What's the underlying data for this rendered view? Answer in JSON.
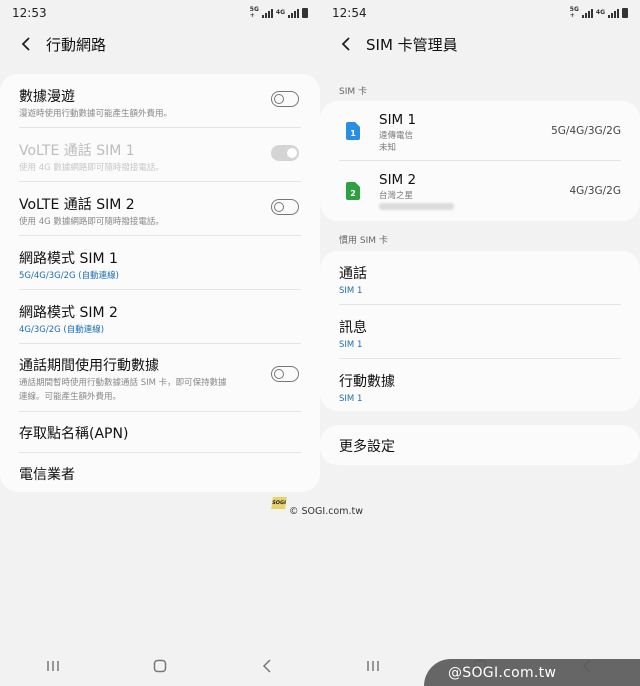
{
  "left": {
    "status_time": "12:53",
    "status_net1": "4G",
    "header_title": "行動網路",
    "rows": [
      {
        "title": "數據漫遊",
        "sub": "漫遊時使用行動數據可能產生額外費用。"
      },
      {
        "title": "VoLTE 通話 SIM 1",
        "sub": "使用 4G 數據網路即可隨時撥接電話。"
      },
      {
        "title": "VoLTE 通話 SIM 2",
        "sub": "使用 4G 數據網路即可隨時撥接電話。"
      },
      {
        "title": "網路模式 SIM 1",
        "sub": "5G/4G/3G/2G (自動連線)"
      },
      {
        "title": "網路模式 SIM 2",
        "sub": "4G/3G/2G (自動連線)"
      },
      {
        "title": "通話期間使用行動數據",
        "sub1": "通話期間暫時使用行動數據通話 SIM 卡，即可保持數據",
        "sub2": "連線。可能產生額外費用。"
      },
      {
        "title": "存取點名稱(APN)"
      },
      {
        "title": "電信業者"
      }
    ]
  },
  "right": {
    "status_time": "12:54",
    "status_net1": "4G",
    "header_title": "SIM 卡管理員",
    "section_sim": "SIM 卡",
    "sims": [
      {
        "name": "SIM 1",
        "badge": "1",
        "carrier": "遠傳電信",
        "number": "未知",
        "mode": "5G/4G/3G/2G"
      },
      {
        "name": "SIM 2",
        "badge": "2",
        "carrier": "台灣之星",
        "mode": "4G/3G/2G"
      }
    ],
    "section_preferred": "慣用 SIM 卡",
    "preferred": [
      {
        "title": "通話",
        "value": "SIM 1"
      },
      {
        "title": "訊息",
        "value": "SIM 1"
      },
      {
        "title": "行動數據",
        "value": "SIM 1"
      }
    ],
    "more_settings": "更多設定"
  },
  "watermark": {
    "small_badge": "SOGI",
    "small_text": "© SOGI.com.tw",
    "big_text": "@SOGI.com.tw"
  },
  "colors": {
    "accent_blue": "#1b6fb5",
    "sim1_icon": "#2a8ee0",
    "sim2_icon": "#2ea043",
    "card_bg": "#fbfbfb",
    "page_bg": "#f2f2f2"
  },
  "toggles": {
    "data_roaming": false,
    "volte_sim1": true,
    "volte_sim1_disabled": true,
    "volte_sim2": false,
    "data_during_calls": false
  }
}
